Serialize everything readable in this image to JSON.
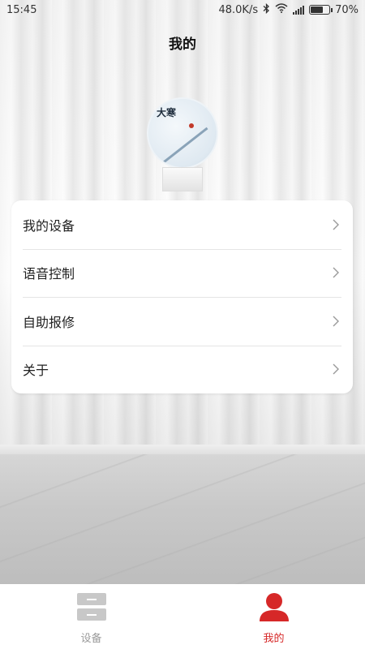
{
  "status_bar": {
    "time": "15:45",
    "net_speed": "48.0K/s",
    "battery_percent": "70%",
    "battery_level": 0.7
  },
  "header": {
    "title": "我的"
  },
  "avatar": {
    "image_text": "大寒"
  },
  "menu": {
    "items": [
      {
        "label": "我的设备"
      },
      {
        "label": "语音控制"
      },
      {
        "label": "自助报修"
      },
      {
        "label": "关于"
      }
    ]
  },
  "bottom_nav": {
    "tabs": [
      {
        "label": "设备",
        "icon": "device-icon",
        "active": false
      },
      {
        "label": "我的",
        "icon": "person-icon",
        "active": true
      }
    ],
    "active_color": "#d62828",
    "inactive_color": "#9a9a9a"
  }
}
